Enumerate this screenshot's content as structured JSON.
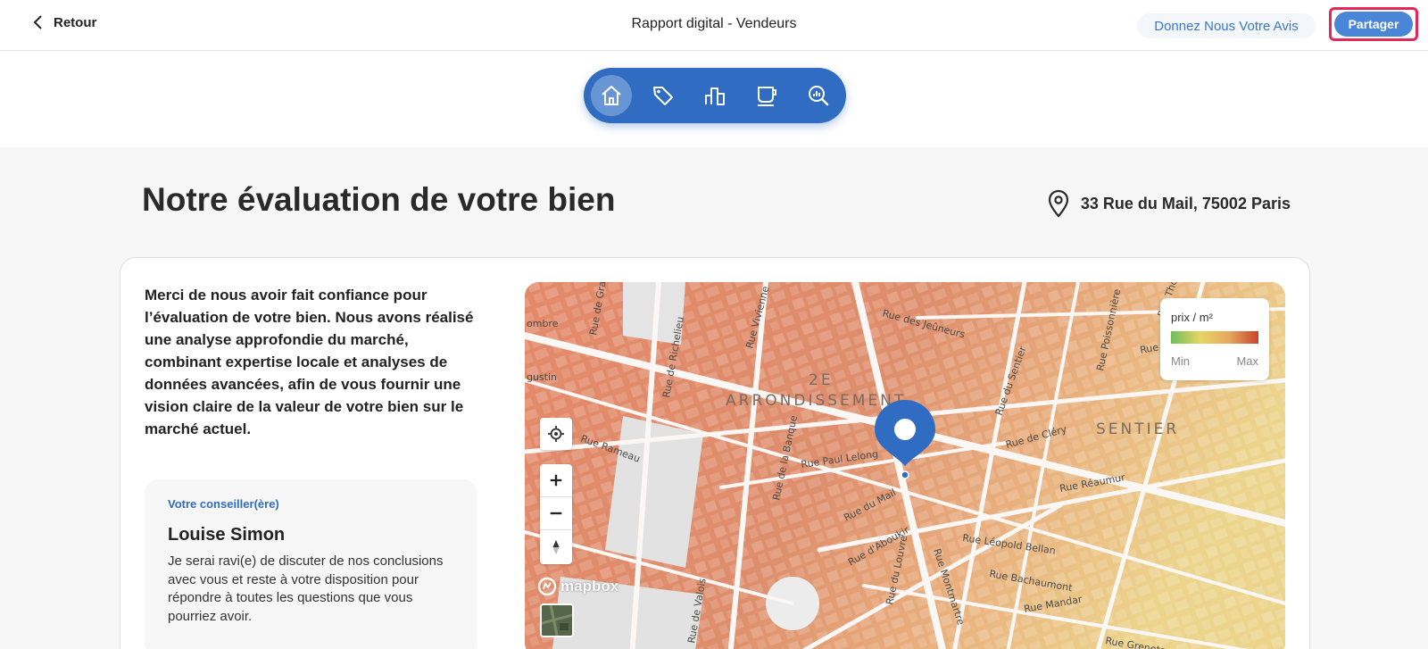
{
  "header": {
    "back_label": "Retour",
    "title": "Rapport digital - Vendeurs",
    "feedback_label": "Donnez Nous Votre Avis",
    "share_label": "Partager"
  },
  "nav": {
    "items": [
      {
        "icon": "home-icon",
        "active": true
      },
      {
        "icon": "tag-icon",
        "active": false
      },
      {
        "icon": "bar-chart-icon",
        "active": false
      },
      {
        "icon": "coffee-cup-icon",
        "active": false
      },
      {
        "icon": "analytics-search-icon",
        "active": false
      }
    ]
  },
  "main": {
    "heading": "Notre évaluation de votre bien",
    "address": "33 Rue du Mail, 75002 Paris",
    "intro": "Merci de nous avoir fait confiance pour l’évaluation de votre bien. Nous avons réalisé une analyse approfondie du marché, combinant expertise locale et analyses de données avancées, afin de vous fournir une vision claire de la valeur de votre bien sur le marché actuel.",
    "advisor": {
      "label": "Votre conseiller(ère)",
      "name": "Louise Simon",
      "description": "Je serai ravi(e) de discuter de nos conclusions avec vous et reste à votre disposition pour répondre à toutes les questions que vous pourriez avoir."
    }
  },
  "map": {
    "legend_title": "prix / m²",
    "legend_min": "Min",
    "legend_max": "Max",
    "attribution": "mapbox",
    "district_labels": [
      "2E",
      "ARRONDISSEMENT",
      "SENTIER"
    ],
    "streets": [
      "Rue de Gram",
      "ombre",
      "gustin",
      "Rue de Richelieu",
      "Rue Vivienne",
      "Rue des Jeûneurs",
      "Rue Poissonnière",
      "Rue du Sentier",
      "Rue de Cléry",
      "Rue Rameau",
      "Rue de la Banque",
      "Rue Paul Lelong",
      "Rue du Mail",
      "Rue d'Aboukir",
      "Rue du Louvre",
      "Rue Montmartre",
      "Rue Léopold Bellan",
      "Rue Bachaumont",
      "Rue Mandar",
      "Rue Greneta",
      "Rue de Valois",
      "Rue Réaumur",
      "Rue Thorel",
      "Rue B"
    ],
    "colors": {
      "low": "#6cbf5a",
      "mid": "#e7d564",
      "high": "#c9432a",
      "pin": "#2f6cc2"
    }
  }
}
